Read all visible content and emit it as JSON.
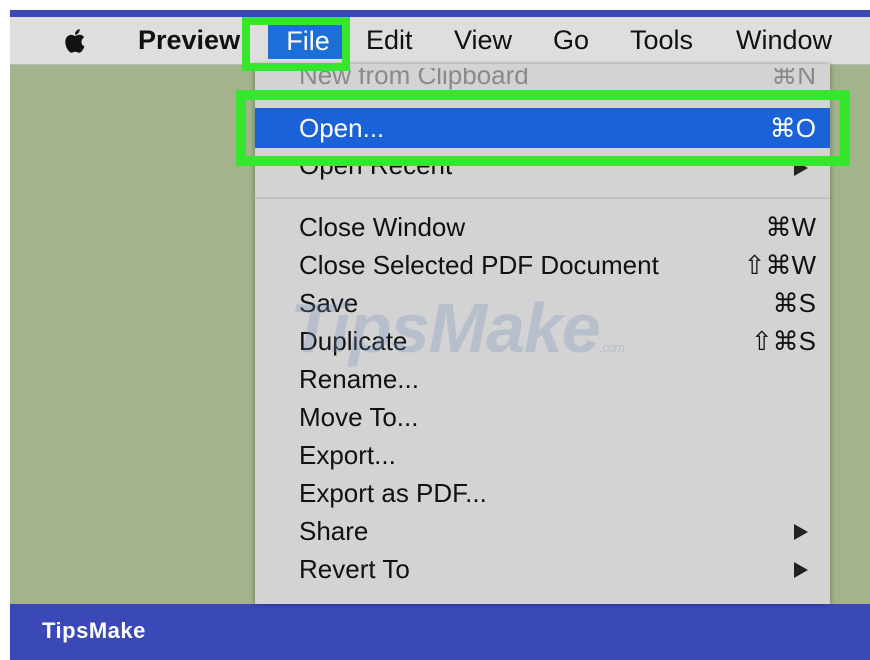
{
  "menubar": {
    "apple_icon": "apple-logo-icon",
    "app_name": "Preview",
    "items": [
      "File",
      "Edit",
      "View",
      "Go",
      "Tools",
      "Window"
    ]
  },
  "file_menu": {
    "items": [
      {
        "label": "New from Clipboard",
        "shortcut": "⌘N"
      },
      {
        "label": "Open...",
        "shortcut": "⌘O"
      },
      {
        "label": "Open Recent",
        "submenu": true
      },
      {
        "label": "Close Window",
        "shortcut": "⌘W"
      },
      {
        "label": "Close Selected PDF Document",
        "shortcut": "⇧⌘W"
      },
      {
        "label": "Save",
        "shortcut": "⌘S"
      },
      {
        "label": "Duplicate",
        "shortcut": "⇧⌘S"
      },
      {
        "label": "Rename..."
      },
      {
        "label": "Move To..."
      },
      {
        "label": "Export..."
      },
      {
        "label": "Export as PDF..."
      },
      {
        "label": "Share",
        "submenu": true
      },
      {
        "label": "Revert To",
        "submenu": true
      }
    ]
  },
  "watermark": {
    "text": "TipsMake",
    "suffix": ".com"
  },
  "footer": {
    "brand": "TipsMake"
  },
  "colors": {
    "frame": "#3a48b8",
    "desktop": "#a3b48d",
    "selection": "#1b62d9",
    "highlight": "#35e62c"
  }
}
